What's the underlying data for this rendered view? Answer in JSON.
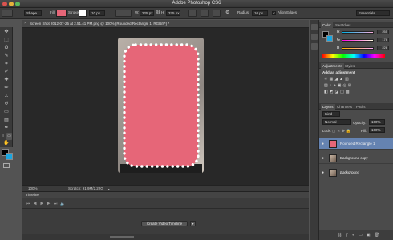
{
  "titlebar": {
    "title": "Adobe Photoshop CS6"
  },
  "options": {
    "tool_mode": "Shape",
    "fill_label": "Fill:",
    "stroke_label": "Stroke:",
    "stroke_width": "10 px",
    "w_label": "W:",
    "w_value": "225 px",
    "h_label": "H:",
    "h_value": "375 px",
    "radius_label": "Radius:",
    "radius_value": "10 px",
    "align_edges_label": "Align Edges",
    "workspace": "Essentials",
    "fill_color": "#e66678",
    "stroke_color": "#ffffff"
  },
  "document": {
    "tab_title": "Screen Shot 2012-07-25 at 2.51.41 PM.png @ 100% (Rounded Rectangle 1, RGB/8*) *",
    "zoom": "100%",
    "scratch": "Scratch: 91.9M/2.22G",
    "shape_color": "#e66678"
  },
  "timeline": {
    "title": "Timeline",
    "create_button": "Create Video Timeline"
  },
  "color_panel": {
    "tabs": [
      "Color",
      "Swatches"
    ],
    "r_label": "R",
    "r_value": "255",
    "g_label": "G",
    "g_value": "176",
    "b_label": "B",
    "b_value": "226"
  },
  "adjustments_panel": {
    "tabs": [
      "Adjustments",
      "Styles"
    ],
    "heading": "Add an adjustment"
  },
  "layers_panel": {
    "tabs": [
      "Layers",
      "Channels",
      "Paths"
    ],
    "kind": "Kind",
    "blend_mode": "Normal",
    "opacity_label": "Opacity:",
    "opacity_value": "100%",
    "lock_label": "Lock:",
    "fill_label": "Fill:",
    "fill_value": "100%",
    "layers": [
      {
        "name": "Rounded Rectangle 1",
        "selected": true
      },
      {
        "name": "Background copy",
        "selected": false
      },
      {
        "name": "Background",
        "selected": false
      }
    ]
  },
  "colors": {
    "accent_selection": "#6583b1",
    "foreground": "#000000",
    "background": "#1aa6e0"
  }
}
